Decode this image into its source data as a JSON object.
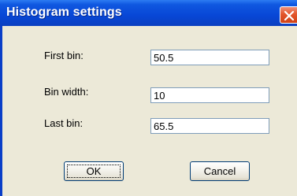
{
  "window": {
    "title": "Histogram settings",
    "close_icon": "close-icon"
  },
  "form": {
    "fields": [
      {
        "label": "First bin:",
        "value": "50.5"
      },
      {
        "label": "Bin width:",
        "value": "10"
      },
      {
        "label": "Last bin:",
        "value": "65.5"
      }
    ]
  },
  "buttons": {
    "ok_label": "OK",
    "cancel_label": "Cancel"
  },
  "colors": {
    "titlebar": "#0a3fc8",
    "dialog_background": "#ece9d8",
    "close_button": "#e3562b"
  }
}
